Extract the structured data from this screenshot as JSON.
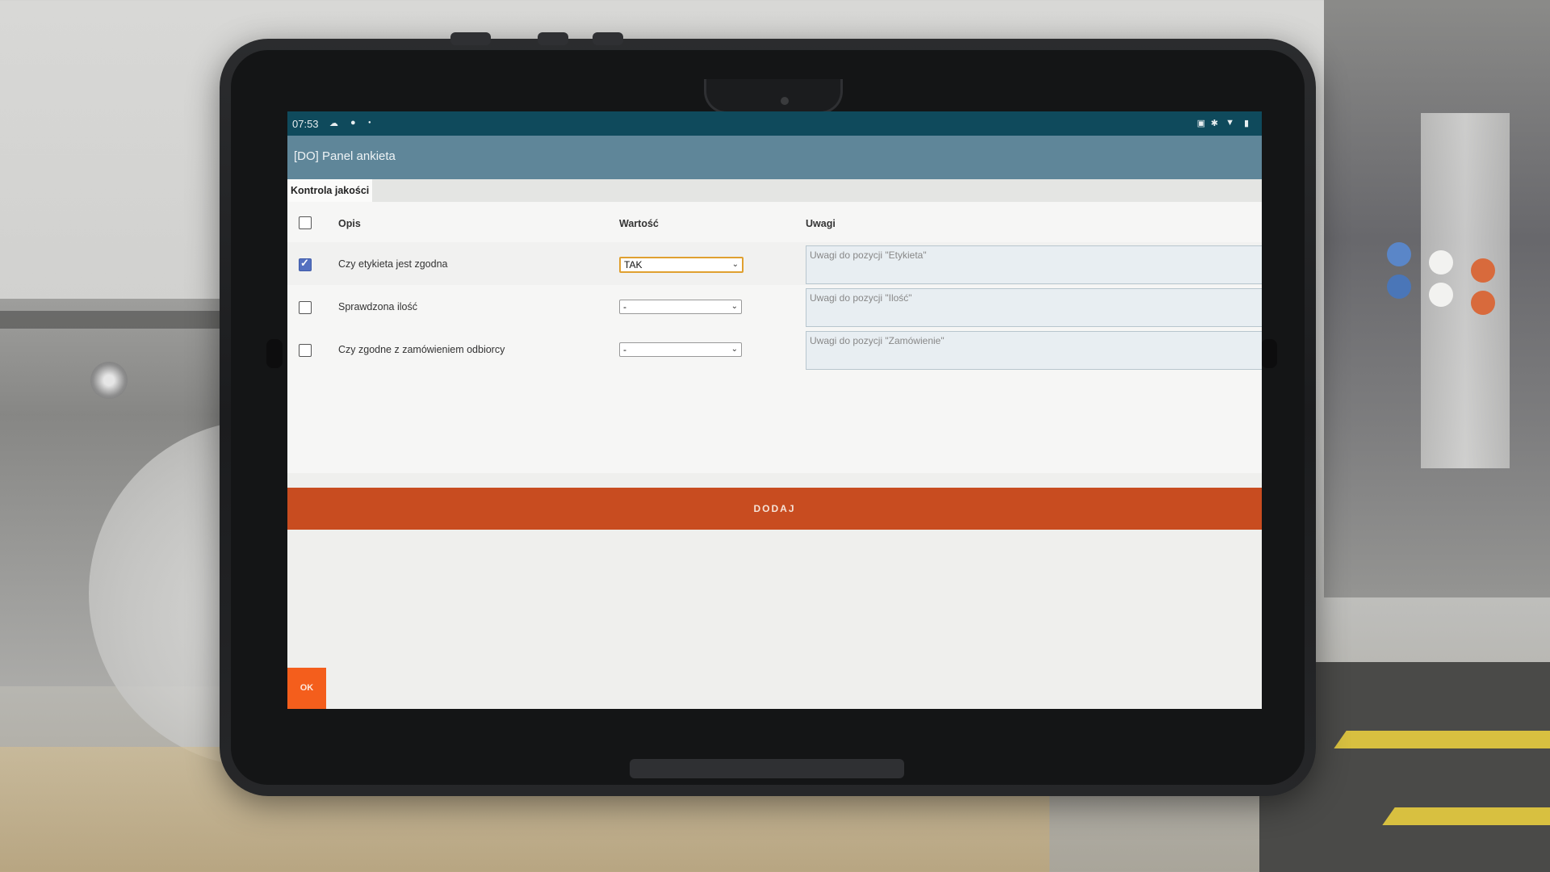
{
  "statusbar": {
    "time": "07:53",
    "icons_left": [
      "cloud-icon",
      "dot-icon",
      "dot-icon"
    ],
    "icons_right": [
      "nfc-icon",
      "bluetooth-icon",
      "wifi-icon",
      "battery-icon"
    ]
  },
  "appbar": {
    "title": "[DO] Panel ankieta"
  },
  "tabs": [
    {
      "label": "Kontrola jakości",
      "active": true
    }
  ],
  "table": {
    "headers": {
      "description": "Opis",
      "value": "Wartość",
      "notes": "Uwagi"
    },
    "rows": [
      {
        "checked": true,
        "label": "Czy etykieta jest zgodna",
        "value": "TAK",
        "note_placeholder": "Uwagi do pozycji \"Etykieta\""
      },
      {
        "checked": false,
        "label": "Sprawdzona ilość",
        "value": "-",
        "note_placeholder": "Uwagi do pozycji \"Ilość\""
      },
      {
        "checked": false,
        "label": "Czy zgodne z zamówieniem odbiorcy",
        "value": "-",
        "note_placeholder": "Uwagi do pozycji \"Zamówienie\""
      }
    ]
  },
  "buttons": {
    "add": "DODAJ",
    "ok": "OK"
  },
  "colors": {
    "statusbar": "#0f4a5c",
    "appbar": "#5f8699",
    "add_button": "#c84c20",
    "ok_button": "#f45e1c",
    "checkbox_checked": "#5470c0"
  }
}
